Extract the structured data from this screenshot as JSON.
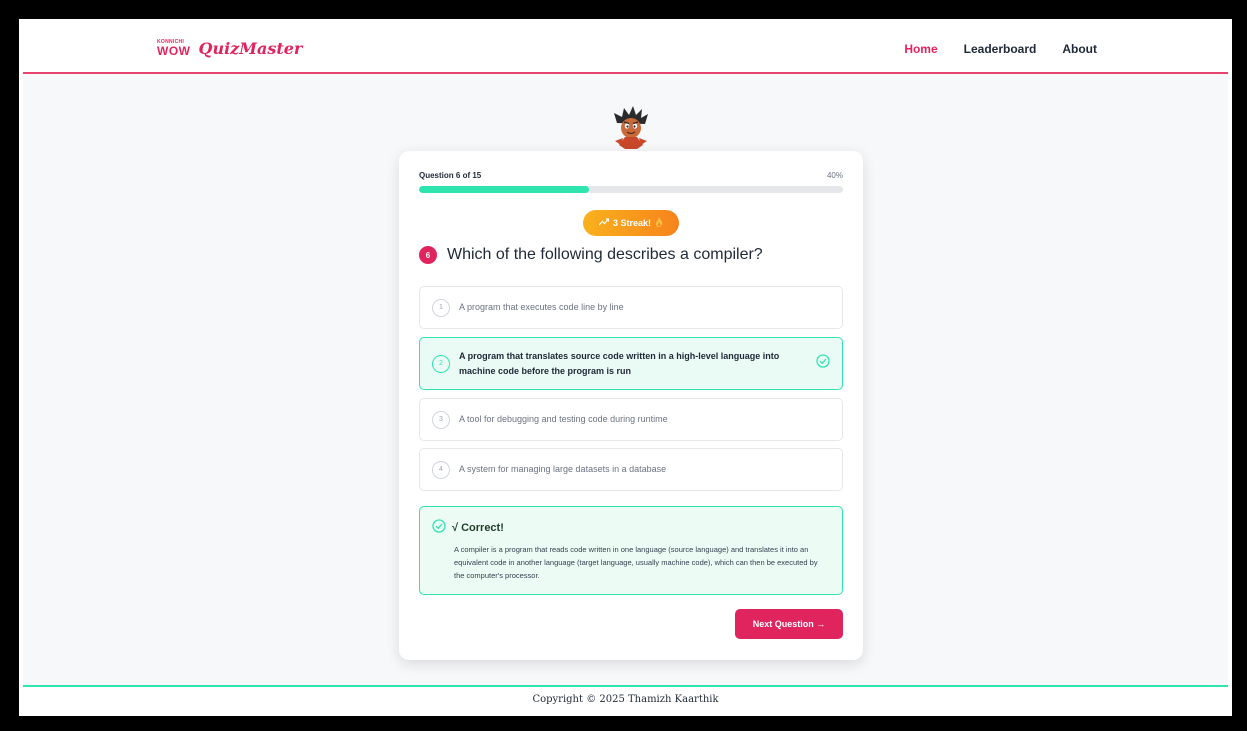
{
  "brand": {
    "logo_small": "KONNICHI",
    "logo_big": "WOW",
    "name": "QuizMaster"
  },
  "nav": {
    "items": [
      {
        "label": "Home",
        "active": true
      },
      {
        "label": "Leaderboard",
        "active": false
      },
      {
        "label": "About",
        "active": false
      }
    ]
  },
  "quiz": {
    "progress_label": "Question 6 of 15",
    "progress_percent_label": "40%",
    "progress_fraction": 0.4,
    "streak_label": "3 Streak!",
    "question_number": "6",
    "question_text": "Which of the following describes a compiler?",
    "options": [
      {
        "num": "1",
        "text": "A program that executes code line by line",
        "correct": false
      },
      {
        "num": "2",
        "text": "A program that translates source code written in a high-level language into machine code before the program is run",
        "correct": true
      },
      {
        "num": "3",
        "text": "A tool for debugging and testing code during runtime",
        "correct": false
      },
      {
        "num": "4",
        "text": "A system for managing large datasets in a database",
        "correct": false
      }
    ],
    "feedback": {
      "title": "√ Correct!",
      "body": "A compiler is a program that reads code written in one language (source language) and translates it into an equivalent code in another language (target language, usually machine code), which can then be executed by the computer's processor."
    },
    "next_label": "Next Question →"
  },
  "footer": {
    "copyright": "Copyright © 2025 Thamizh Kaarthik"
  },
  "colors": {
    "accent": "#e0245e",
    "success": "#2ee5b0",
    "streak_start": "#f9b11c",
    "streak_end": "#f7831b"
  },
  "icons": {
    "mascot": "cartoon-character-icon",
    "streak": "trending-up-icon",
    "streak_emoji": "fire-icon",
    "correct": "check-circle-icon"
  }
}
